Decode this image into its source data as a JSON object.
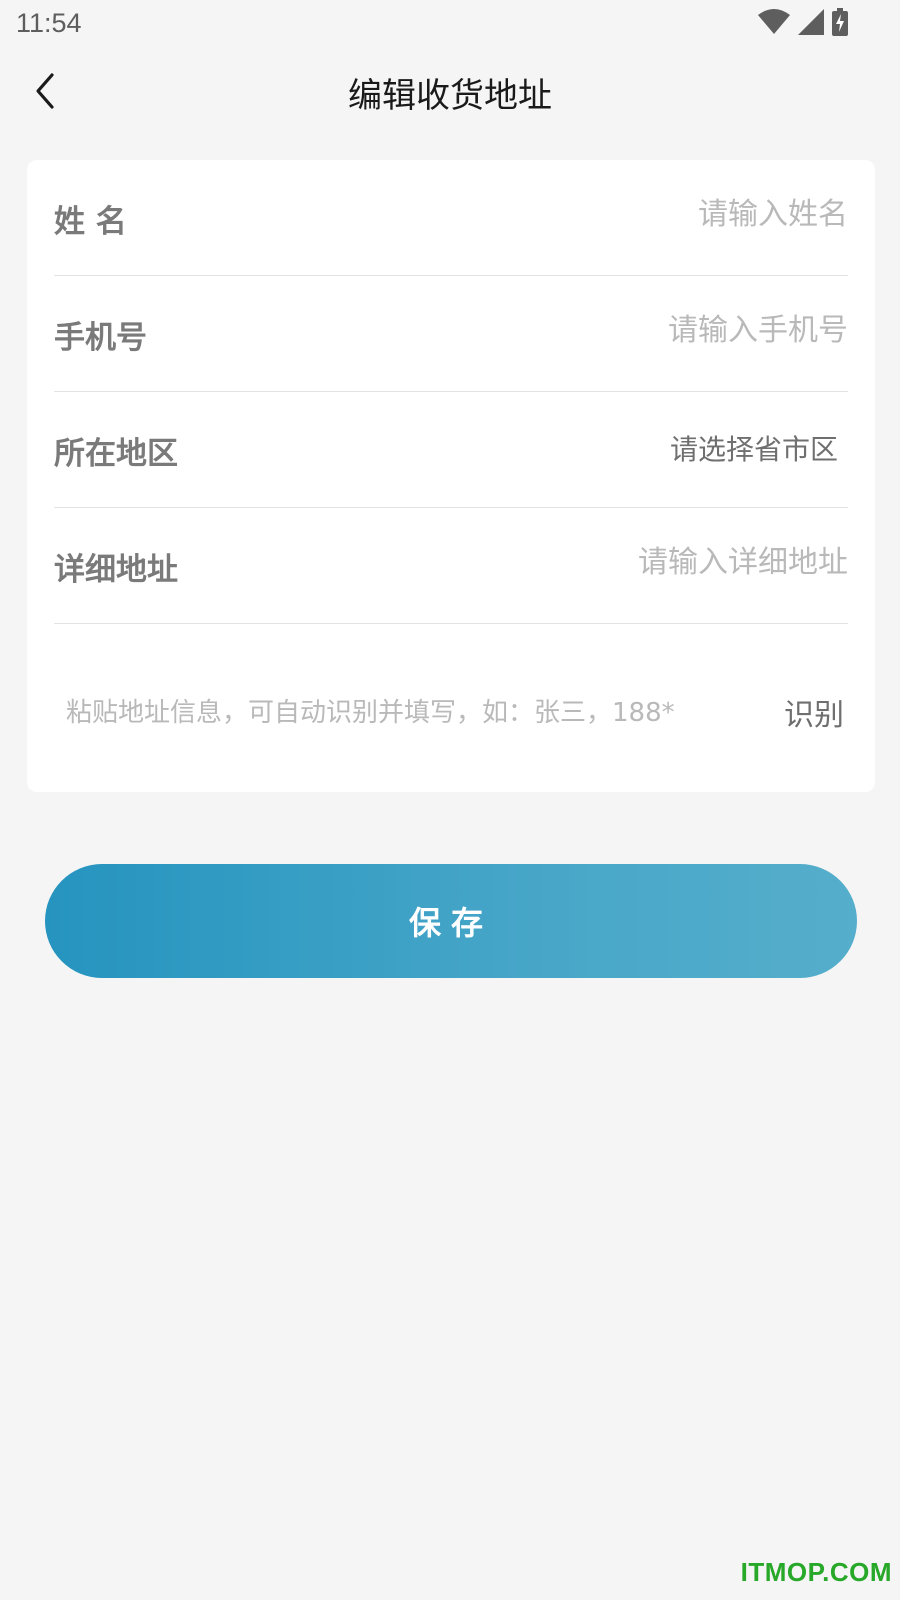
{
  "status_bar": {
    "time": "11:54",
    "icons": [
      "wifi-icon",
      "signal-icon",
      "battery-charging-icon"
    ]
  },
  "header": {
    "title": "编辑收货地址",
    "back_icon": "chevron-left-icon"
  },
  "form": {
    "name": {
      "label": "姓 名",
      "placeholder": "请输入姓名",
      "value": ""
    },
    "phone": {
      "label": "手机号",
      "placeholder": "请输入手机号",
      "value": ""
    },
    "region": {
      "label": "所在地区",
      "select_text": "请选择省市区"
    },
    "detail": {
      "label": "详细地址",
      "placeholder": "请输入详细地址",
      "value": ""
    },
    "paste": {
      "hint": "粘贴地址信息，可自动识别并填写，如：张三，188*",
      "recognize_label": "识别"
    }
  },
  "save_button": {
    "label": "保存",
    "gradient_start": "#2594bf",
    "gradient_end": "#55aecb"
  },
  "watermark": "ITMOP.COM"
}
